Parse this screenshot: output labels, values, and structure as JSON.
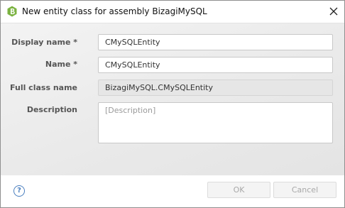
{
  "window": {
    "title": "New entity class for assembly BizagiMySQL",
    "close_icon": "close-icon",
    "app_icon": "bizagi-logo-icon"
  },
  "form": {
    "display_name": {
      "label": "Display name *",
      "value": "CMySQLEntity"
    },
    "name": {
      "label": "Name *",
      "value": "CMySQLEntity"
    },
    "full_class_name": {
      "label": "Full class name",
      "value": "BizagiMySQL.CMySQLEntity"
    },
    "description": {
      "label": "Description",
      "value": "",
      "placeholder": "[Description]"
    }
  },
  "footer": {
    "help_icon": "question-circle-icon",
    "ok_label": "OK",
    "cancel_label": "Cancel"
  },
  "colors": {
    "accent": "#4a7fbf",
    "logo": "#7cb342"
  }
}
